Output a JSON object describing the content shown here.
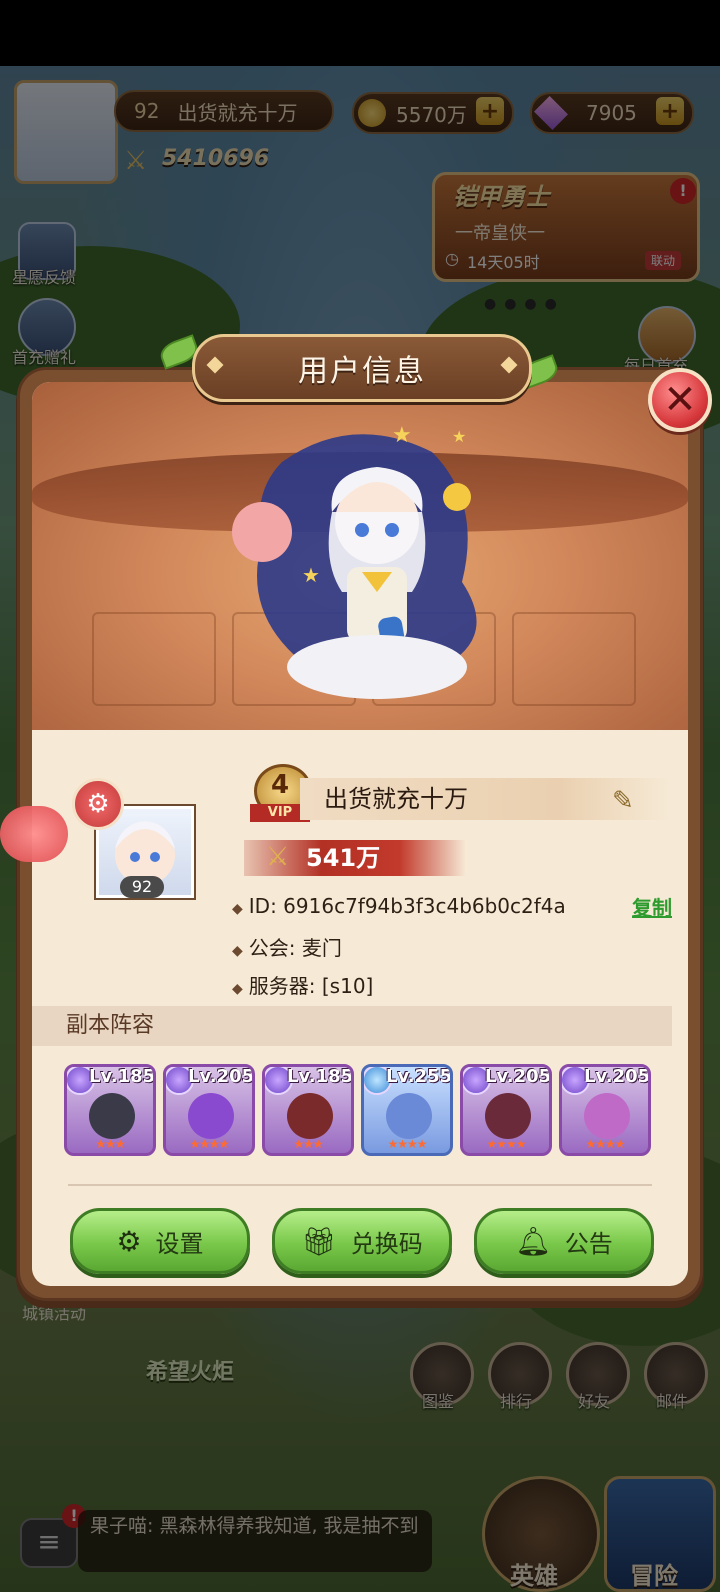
{
  "hud": {
    "player_level": "92",
    "player_name": "出货就充十万",
    "power": "5410696",
    "gold": "5570万",
    "gems": "7905"
  },
  "event_banner": {
    "title": "铠甲勇士",
    "subtitle": "一帝皇侠一",
    "timer": "14天05时",
    "tag": "联动"
  },
  "side_menu_left": [
    "星愿反馈",
    "首充赠礼"
  ],
  "side_menu_right": [
    "每日首充"
  ],
  "dialog": {
    "title": "用户信息",
    "avatar_level": "92",
    "vip_level": "4",
    "vip_label": "VIP",
    "name": "出货就充十万",
    "power": "541万",
    "id_label": "ID: 6916c7f94b3f3c4b6b0c2f4a",
    "copy_label": "复制",
    "guild_label": "公会: 麦门",
    "server_label": "服务器: [s10]",
    "lineup_title": "副本阵容",
    "heroes": [
      {
        "level": "Lv.185",
        "stars": "★★★",
        "color": "#3a3a48"
      },
      {
        "level": "Lv.205",
        "stars": "★★★★",
        "color": "#8a4ad0"
      },
      {
        "level": "Lv.185",
        "stars": "★★★",
        "color": "#7a2a2a"
      },
      {
        "level": "Lv.255",
        "stars": "★★★★",
        "color": "#6a8ad8"
      },
      {
        "level": "Lv.205",
        "stars": "★★★★",
        "color": "#6a2a3a"
      },
      {
        "level": "Lv.205",
        "stars": "★★★★",
        "color": "#c06ac8"
      }
    ],
    "buttons": {
      "settings": "设置",
      "redeem": "兑换码",
      "notice": "公告"
    }
  },
  "background_labels": {
    "torch": "希望火炬",
    "city_event": "城镇活动"
  },
  "bottom_nav": [
    "图鉴",
    "排行",
    "好友",
    "邮件"
  ],
  "bottom_main": [
    "英雄",
    "冒险"
  ],
  "chat": {
    "message": "果子喵: 黑森林得养我知道, 我是抽不到"
  },
  "colors": {
    "accent_green": "#79c84a",
    "close_red": "#d6373b",
    "dialog_brown": "#7a4f2f"
  }
}
